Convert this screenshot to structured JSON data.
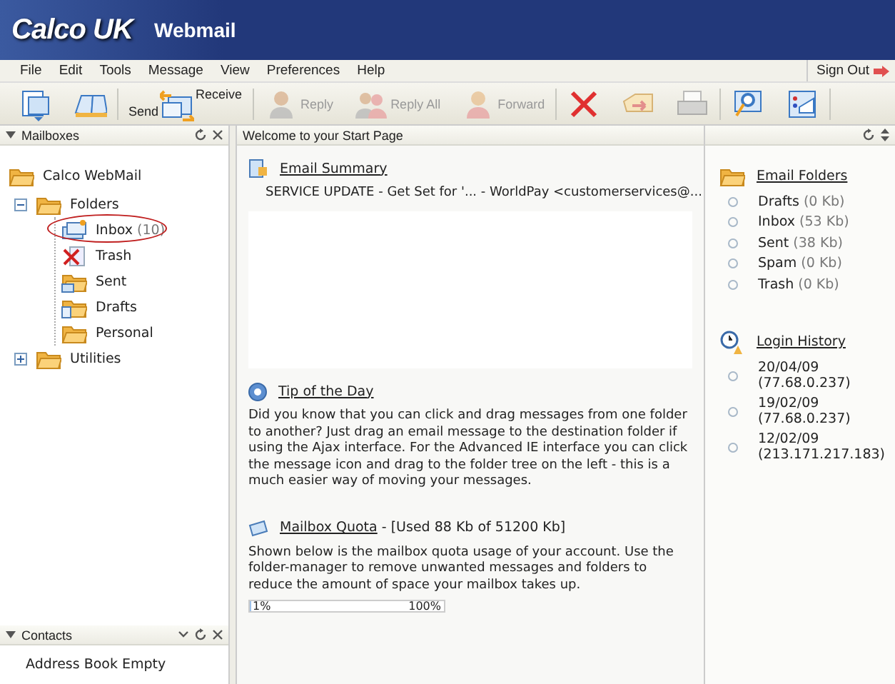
{
  "header": {
    "logo": "Calco UK",
    "title": "Webmail"
  },
  "menu": [
    "File",
    "Edit",
    "Tools",
    "Message",
    "View",
    "Preferences",
    "Help"
  ],
  "sign_out": "Sign Out",
  "toolbar": [
    {
      "kind": "new",
      "disabled": false
    },
    {
      "kind": "book",
      "disabled": false
    },
    {
      "kind": "sendreceive",
      "label": "Send",
      "label2": "Receive",
      "disabled": false
    },
    {
      "kind": "reply",
      "label": "Reply",
      "disabled": true
    },
    {
      "kind": "replyall",
      "label": "Reply All",
      "disabled": true
    },
    {
      "kind": "forward",
      "label": "Forward",
      "disabled": true
    },
    {
      "kind": "delete",
      "disabled": false
    },
    {
      "kind": "move",
      "disabled": true
    },
    {
      "kind": "print",
      "disabled": true
    },
    {
      "kind": "search",
      "disabled": false
    },
    {
      "kind": "settings",
      "disabled": false
    }
  ],
  "mailboxes": {
    "title": "Mailboxes",
    "tree": [
      {
        "label": "Calco WebMail",
        "kind": "root",
        "children": [
          {
            "label": "Folders",
            "kind": "folder",
            "expanded": true,
            "children": [
              {
                "label": "Inbox",
                "count": "(10)",
                "kind": "inbox",
                "circled": true
              },
              {
                "label": "Trash",
                "kind": "trash",
                "circled": false
              },
              {
                "label": "Sent",
                "kind": "sent",
                "circled": false
              },
              {
                "label": "Drafts",
                "kind": "drafts",
                "circled": false
              },
              {
                "label": "Personal",
                "kind": "folder",
                "circled": false
              }
            ]
          },
          {
            "label": "Utilities",
            "kind": "folder",
            "expanded": false
          }
        ]
      }
    ]
  },
  "contacts": {
    "title": "Contacts",
    "text": "Address Book Empty"
  },
  "start_page": {
    "title": "Welcome to your Start Page",
    "email_summary": {
      "heading": "Email Summary",
      "messages": [
        "SERVICE UPDATE - Get Set for '... - WorldPay <customerservices@..."
      ]
    },
    "tip": {
      "heading": "Tip of the Day",
      "text": "Did you know that you can click and drag messages from one folder to another? Just drag an email message to the destination folder if using the Ajax interface. For the Advanced IE interface you can click the message icon and drag to the folder tree on the left - this is a much easier way of moving your messages."
    },
    "quota": {
      "heading": "Mailbox Quota",
      "detail": "- [Used 88 Kb of 51200 Kb]",
      "text": "Shown below is the mailbox quota usage of your account. Use the folder-manager to remove unwanted messages and folders to reduce the amount of space your mailbox takes up.",
      "level": 0.01,
      "min_label": "1%",
      "max_label": "100%"
    }
  },
  "email_folders": {
    "heading": "Email Folders",
    "items": [
      {
        "name": "Drafts",
        "size": "(0 Kb)"
      },
      {
        "name": "Inbox",
        "size": "(53 Kb)"
      },
      {
        "name": "Sent",
        "size": "(38 Kb)"
      },
      {
        "name": "Spam",
        "size": "(0 Kb)"
      },
      {
        "name": "Trash",
        "size": "(0 Kb)"
      }
    ]
  },
  "login_history": {
    "heading": "Login History",
    "items": [
      {
        "date": "20/04/09",
        "ip": "(77.68.0.237)"
      },
      {
        "date": "19/02/09",
        "ip": "(77.68.0.237)"
      },
      {
        "date": "12/02/09",
        "ip": "(213.171.217.183)"
      }
    ]
  }
}
